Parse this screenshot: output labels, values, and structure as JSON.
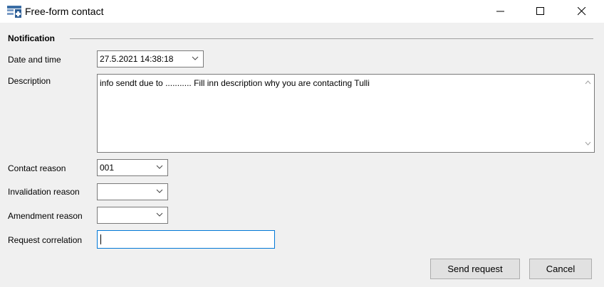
{
  "window": {
    "title": "Free-form contact",
    "icon": "form-app-icon",
    "controls": [
      "minimize-icon",
      "maximize-icon",
      "close-icon"
    ]
  },
  "group": {
    "label": "Notification"
  },
  "fields": {
    "date_time": {
      "label": "Date and time",
      "value": "27.5.2021 14:38:18"
    },
    "description": {
      "label": "Description",
      "value": "info sendt due to ........... Fill inn description why you are contacting Tulli"
    },
    "contact_reason": {
      "label": "Contact reason",
      "value": "001"
    },
    "invalidation_reason": {
      "label": "Invalidation reason",
      "value": ""
    },
    "amendment_reason": {
      "label": "Amendment reason",
      "value": ""
    },
    "request_correlation": {
      "label": "Request correlation",
      "value": ""
    }
  },
  "buttons": {
    "send": "Send request",
    "cancel": "Cancel"
  },
  "colors": {
    "focus_border": "#0078d7",
    "button_bg": "#e1e1e1",
    "window_bg": "#f0f0f0"
  }
}
